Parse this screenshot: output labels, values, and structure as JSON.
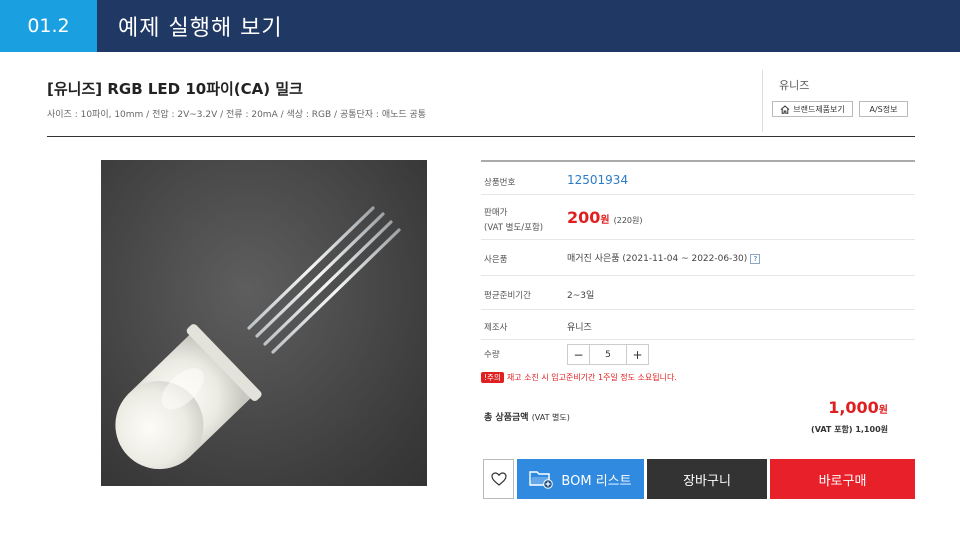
{
  "slide": {
    "number": "01.2",
    "title": "예제 실행해 보기"
  },
  "product": {
    "title": "[유니즈] RGB LED 10파이(CA) 밀크",
    "spec": "사이즈 : 10파이, 10mm / 전압 : 2V~3.2V / 전류 : 20mA / 색상 : RGB / 공통단자 : 애노드 공통"
  },
  "brand": {
    "name": "유니즈",
    "products_btn": "브랜드제품보기",
    "as_btn": "A/S정보"
  },
  "info": {
    "code_label": "상품번호",
    "code": "12501934",
    "price_label_1": "판매가",
    "price_label_2": "(VAT 별도/포함)",
    "price": "200",
    "price_unit": "원",
    "price_vat": "(220원)",
    "usage_label": "사은품",
    "usage": "매거진 사은품 (2021-11-04 ~ 2022-06-30)",
    "usage_help": "?",
    "prep_label": "평균준비기간",
    "prep": "2~3일",
    "maker_label": "제조사",
    "maker": "유니즈",
    "qty_label": "수량",
    "qty_minus": "−",
    "qty_value": "5",
    "qty_plus": "+"
  },
  "notice": {
    "badge": "!주의",
    "text": "재고 소진 시 입고준비기간 1주일 정도 소요됩니다."
  },
  "total": {
    "label": "총 상품금액",
    "label_sub": "(VAT 별도)",
    "value": "1,000",
    "unit": "원",
    "vat_label": "(VAT 포함)",
    "vat_value": "1,100원"
  },
  "buttons": {
    "bom": "BOM 리스트",
    "cart": "장바구니",
    "buy": "바로구매"
  },
  "colors": {
    "header": "#1f3864",
    "accent": "#1aa0e0",
    "price": "#e02020",
    "bom": "#2f8ae0",
    "buy": "#e8202a"
  }
}
